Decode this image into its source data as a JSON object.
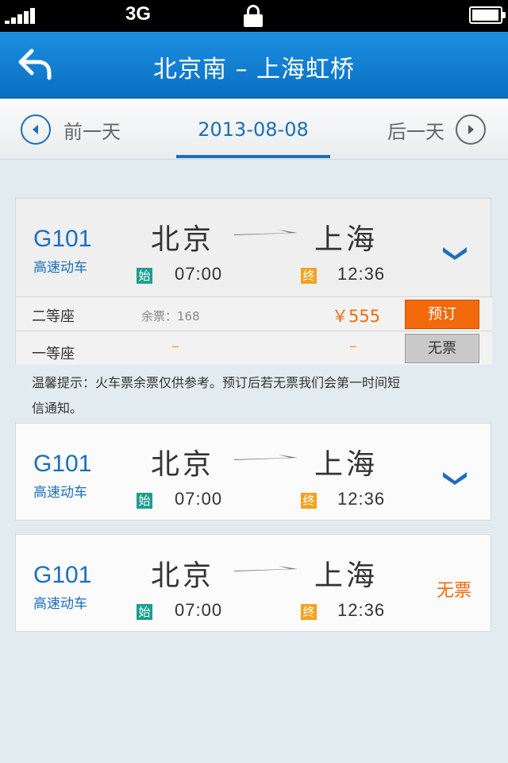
{
  "status_bar": {
    "network": "3G"
  },
  "nav": {
    "title": "北京南 – 上海虹桥",
    "back_icon": "back-arrow-icon"
  },
  "date_bar": {
    "prev_label": "前一天",
    "date": "2013-08-08",
    "next_label": "后一天"
  },
  "trains": [
    {
      "code": "G101",
      "kind": "高速动车",
      "from": "北京",
      "to": "上海",
      "start_tag": "始",
      "end_tag": "终",
      "depart": "07:00",
      "arrive": "12:36",
      "expanded": true,
      "seats": [
        {
          "name": "二等座",
          "left_label": "余票：168",
          "price": "￥555",
          "action": "预订"
        },
        {
          "name": "一等座",
          "left_dash": "–",
          "price_dash": "–",
          "action": "无票"
        }
      ]
    },
    {
      "code": "G101",
      "kind": "高速动车",
      "from": "北京",
      "to": "上海",
      "start_tag": "始",
      "end_tag": "终",
      "depart": "07:00",
      "arrive": "12:36"
    },
    {
      "code": "G101",
      "kind": "高速动车",
      "from": "北京",
      "to": "上海",
      "start_tag": "始",
      "end_tag": "终",
      "depart": "07:00",
      "arrive": "12:36",
      "status": "无票"
    }
  ],
  "tip": "温馨提示：火车票余票仅供参考。预订后若无票我们会第一时间短信通知。",
  "colors": {
    "accent": "#1b6fbb",
    "orange": "#f16b0c",
    "start_tag": "#1c9d8e",
    "end_tag": "#f3a21c"
  }
}
